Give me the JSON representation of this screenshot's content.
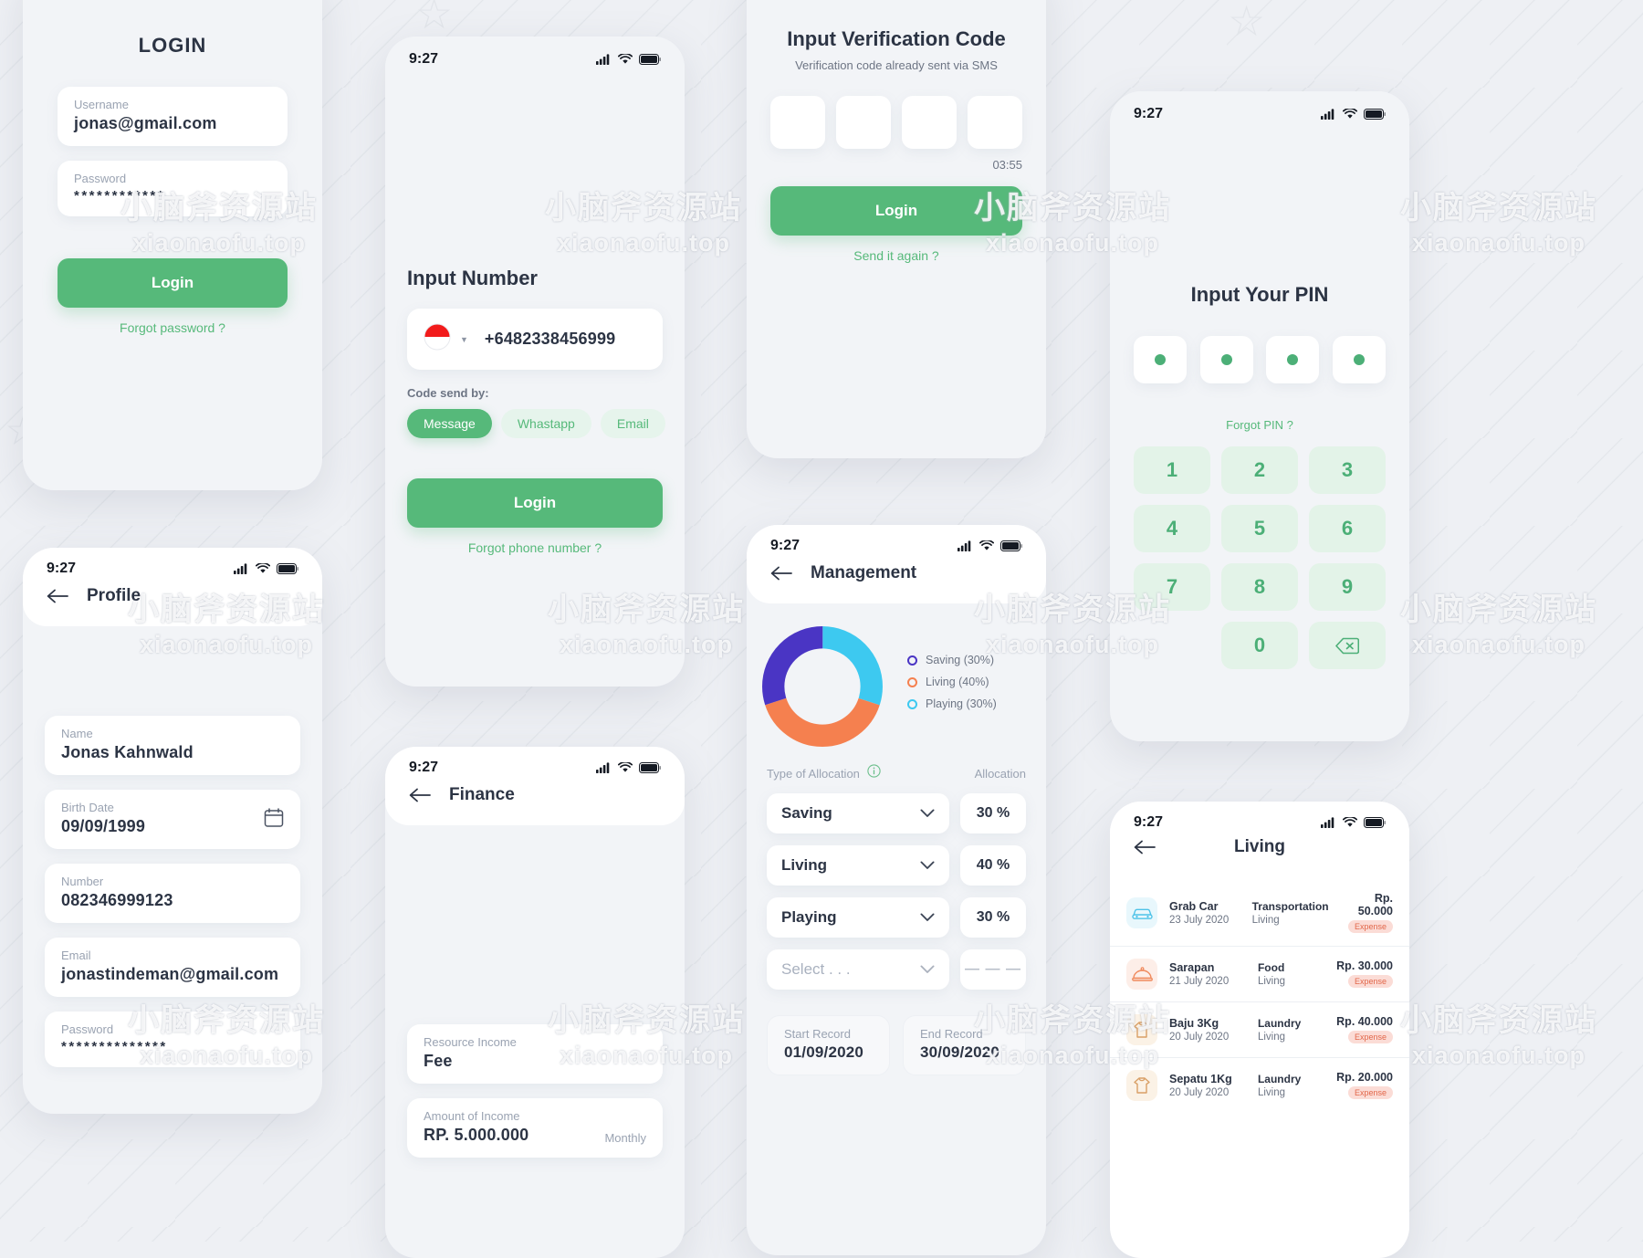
{
  "watermark": {
    "cn": "小脑斧资源站",
    "en": "xiaonaofu.top"
  },
  "colors": {
    "accent_green": "#56b97a",
    "saving_purple": "#4A35C4",
    "living_orange": "#F5804F",
    "playing_cyan": "#3DC9F0",
    "text_dark": "#2c3444",
    "label_gray": "#9aa3b2"
  },
  "status_bar": {
    "time": "9:27"
  },
  "login": {
    "title": "LOGIN",
    "username": {
      "label": "Username",
      "value": "jonas@gmail.com"
    },
    "password": {
      "label": "Password",
      "value": "************"
    },
    "login_button": "Login",
    "forgot_link": "Forgot password ?"
  },
  "input_number": {
    "title": "Input Number",
    "phone_value": "+6482338456999",
    "country_flag": "indonesia-flag-icon",
    "code_send_label": "Code send by:",
    "options": [
      {
        "label": "Message",
        "active": true
      },
      {
        "label": "Whastapp",
        "active": false
      },
      {
        "label": "Email",
        "active": false
      }
    ],
    "login_button": "Login",
    "forgot_link": "Forgot phone number ?"
  },
  "verification": {
    "title": "Input Verification Code",
    "subtitle": "Verification code already sent via SMS",
    "boxes": [
      "",
      "",
      "",
      ""
    ],
    "timer": "03:55",
    "login_button": "Login",
    "resend_link": "Send it again ?"
  },
  "pin": {
    "title": "Input Your PIN",
    "dots": [
      true,
      true,
      true,
      true
    ],
    "forgot_link": "Forgot PIN ?",
    "keys": [
      "1",
      "2",
      "3",
      "4",
      "5",
      "6",
      "7",
      "8",
      "9",
      "0",
      "backspace-icon"
    ]
  },
  "profile": {
    "nav_title": "Profile",
    "fields": [
      {
        "label": "Name",
        "value": "Jonas Kahnwald",
        "icon": ""
      },
      {
        "label": "Birth Date",
        "value": "09/09/1999",
        "icon": "calendar-icon"
      },
      {
        "label": "Number",
        "value": "082346999123",
        "icon": ""
      },
      {
        "label": "Email",
        "value": "jonastindeman@gmail.com",
        "icon": ""
      },
      {
        "label": "Password",
        "value": "**************",
        "icon": ""
      }
    ]
  },
  "finance": {
    "nav_title": "Finance",
    "fields": [
      {
        "label": "Resource Income",
        "value": "Fee",
        "suffix": ""
      },
      {
        "label": "Amount of Income",
        "value": "RP. 5.000.000",
        "suffix": "Monthly"
      }
    ]
  },
  "management": {
    "nav_title": "Management",
    "type_label": "Type of Allocation",
    "info_icon": "info-icon",
    "allocation_label": "Allocation",
    "rows": [
      {
        "type": "Saving",
        "allocation": "30 %"
      },
      {
        "type": "Living",
        "allocation": "40 %"
      },
      {
        "type": "Playing",
        "allocation": "30 %"
      },
      {
        "type": "Select . . .",
        "allocation": "— — —"
      }
    ],
    "start_record": {
      "label": "Start Record",
      "value": "01/09/2020"
    },
    "end_record": {
      "label": "End Record",
      "value": "30/09/2020"
    }
  },
  "chart_data": {
    "type": "pie",
    "title": "Management",
    "categories": [
      "Saving",
      "Living",
      "Playing"
    ],
    "values": [
      30,
      40,
      30
    ],
    "unit": "%",
    "colors": [
      "#4A35C4",
      "#F5804F",
      "#3DC9F0"
    ],
    "legend": [
      "Saving (30%)",
      "Living (40%)",
      "Playing (30%)"
    ],
    "legend_position": "right",
    "donut": true,
    "inner_radius_ratio": 0.62
  },
  "living": {
    "nav_title": "Living",
    "transactions": [
      {
        "icon": "car-icon",
        "icon_color": "#4fc3e8",
        "name": "Grab Car",
        "date": "23 July 2020",
        "category": "Transportation",
        "sub": "Living",
        "amount": "Rp. 50.000",
        "badge": "Expense"
      },
      {
        "icon": "food-icon",
        "icon_color": "#f08a5d",
        "name": "Sarapan",
        "date": "21 July 2020",
        "category": "Food",
        "sub": "Living",
        "amount": "Rp. 30.000",
        "badge": "Expense"
      },
      {
        "icon": "laundry-icon",
        "icon_color": "#d9a066",
        "name": "Baju 3Kg",
        "date": "20 July 2020",
        "category": "Laundry",
        "sub": "Living",
        "amount": "Rp. 40.000",
        "badge": "Expense"
      },
      {
        "icon": "laundry-icon",
        "icon_color": "#d9a066",
        "name": "Sepatu 1Kg",
        "date": "20 July 2020",
        "category": "Laundry",
        "sub": "Living",
        "amount": "Rp. 20.000",
        "badge": "Expense"
      }
    ]
  }
}
